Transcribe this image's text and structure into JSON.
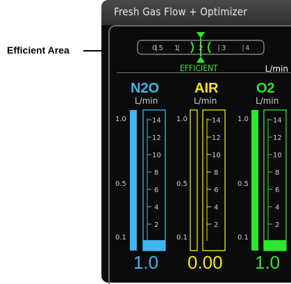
{
  "callout": {
    "label": "Efficient Area"
  },
  "header": {
    "title": "Fresh Gas Flow + Optimizer"
  },
  "optimizer": {
    "ticks": [
      "0.5",
      "1",
      "2",
      "3",
      "4"
    ],
    "efficient_label": "EFFICIENT",
    "unit": "L/min"
  },
  "gases": [
    {
      "name": "N2O",
      "unit": "L/min",
      "value": "1.0",
      "color": "#3fb6f0",
      "fill_fraction": 0.08,
      "left_scale": [
        "1.0",
        "0.5",
        "0.1"
      ],
      "tube_scale": [
        "14",
        "12",
        "10",
        "8",
        "6",
        "4",
        "2"
      ]
    },
    {
      "name": "AIR",
      "unit": "L/min",
      "value": "0.00",
      "color": "#f2ea0a",
      "fill_fraction": 0,
      "left_scale": [
        "1.0",
        "0.5",
        "0.1"
      ],
      "tube_scale": [
        "14",
        "12",
        "10",
        "8",
        "6",
        "4",
        "2"
      ]
    },
    {
      "name": "O2",
      "unit": "L/min",
      "value": "1.0",
      "color": "#2ee62e",
      "fill_fraction": 0.08,
      "left_scale": [
        "1.0",
        "0.5",
        "0.1"
      ],
      "tube_scale": [
        "14",
        "12",
        "10",
        "8",
        "6",
        "4",
        "2"
      ]
    }
  ],
  "colors": {
    "accent_green": "#2ee62e",
    "background": "#0b0b0b"
  }
}
